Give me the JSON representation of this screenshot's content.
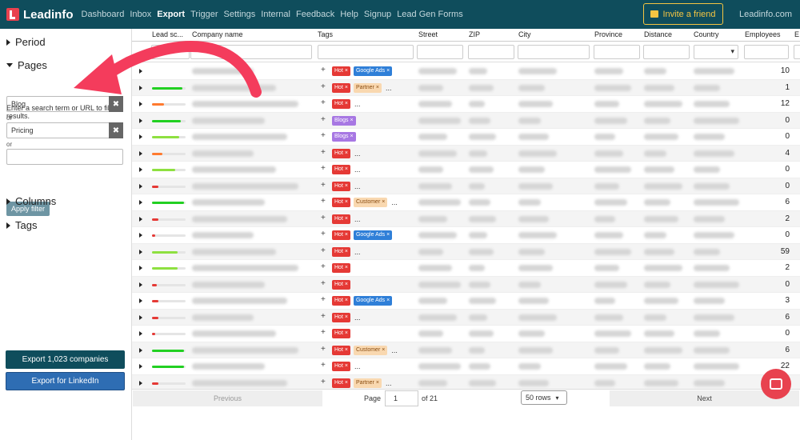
{
  "nav": {
    "brand": "Leadinfo",
    "links": [
      "Dashboard",
      "Inbox",
      "Export",
      "Trigger",
      "Settings",
      "Internal",
      "Feedback",
      "Help",
      "Signup",
      "Lead Gen Forms"
    ],
    "active": "Export",
    "invite_label": "Invite a friend",
    "domain": "Leadinfo.com"
  },
  "sidebar": {
    "period": "Period",
    "pages": "Pages",
    "hint": "Enter a search term or URL to filter results.",
    "filters": [
      {
        "value": "Blog"
      },
      {
        "value": "Pricing"
      },
      {
        "value": ""
      }
    ],
    "or_label": "or",
    "apply": "Apply filter",
    "columns": "Columns",
    "tags": "Tags",
    "export_companies": "Export 1,023 companies",
    "export_linkedin": "Export for LinkedIn"
  },
  "table": {
    "columns": [
      "Lead sc...",
      "Company name",
      "Tags",
      "Street",
      "ZIP",
      "City",
      "Province",
      "Distance",
      "Country",
      "Employees",
      "E"
    ],
    "rows": [
      {
        "score": 0.0,
        "tags": [],
        "employees": "10"
      },
      {
        "score": 0.9,
        "tags": [
          "hot",
          "partner"
        ],
        "more": true,
        "employees": "1"
      },
      {
        "score": 0.35,
        "tags": [
          "hot"
        ],
        "more": true,
        "employees": "12"
      },
      {
        "score": 0.85,
        "tags": [
          "blogs"
        ],
        "more": false,
        "employees": "0"
      },
      {
        "score": 0.8,
        "tags": [
          "blogs"
        ],
        "more": false,
        "employees": "0"
      },
      {
        "score": 0.3,
        "tags": [
          "hot"
        ],
        "more": true,
        "employees": "4"
      },
      {
        "score": 0.7,
        "tags": [
          "hot"
        ],
        "more": true,
        "employees": "0"
      },
      {
        "score": 0.2,
        "tags": [
          "hot"
        ],
        "more": true,
        "employees": "0"
      },
      {
        "score": 0.95,
        "tags": [
          "hot",
          "customer"
        ],
        "more": true,
        "employees": "6"
      },
      {
        "score": 0.2,
        "tags": [
          "hot"
        ],
        "more": true,
        "employees": "2"
      },
      {
        "score": 0.1,
        "tags": [
          "hot",
          "google"
        ],
        "more": false,
        "employees": "0"
      },
      {
        "score": 0.75,
        "tags": [
          "hot"
        ],
        "more": true,
        "employees": "59"
      },
      {
        "score": 0.75,
        "tags": [
          "hot"
        ],
        "more": false,
        "employees": "2"
      },
      {
        "score": 0.15,
        "tags": [
          "hot"
        ],
        "more": false,
        "employees": "0"
      },
      {
        "score": 0.2,
        "tags": [
          "hot",
          "google"
        ],
        "more": false,
        "employees": "3"
      },
      {
        "score": 0.2,
        "tags": [
          "hot"
        ],
        "more": true,
        "employees": "6"
      },
      {
        "score": 0.1,
        "tags": [
          "hot"
        ],
        "more": false,
        "employees": "0"
      },
      {
        "score": 0.95,
        "tags": [
          "hot",
          "customer"
        ],
        "more": true,
        "employees": "6"
      },
      {
        "score": 0.95,
        "tags": [
          "hot"
        ],
        "more": true,
        "employees": "22"
      },
      {
        "score": 0.2,
        "tags": [
          "hot",
          "partner"
        ],
        "more": true,
        "employees": "1"
      }
    ],
    "first_row_tags": [
      "hot",
      "google"
    ]
  },
  "tag_labels": {
    "hot": "Hot",
    "google": "Google Ads",
    "blogs": "Blogs",
    "partner": "Partner",
    "customer": "Customer"
  },
  "pager": {
    "prev": "Previous",
    "next": "Next",
    "page_label": "Page",
    "page": "1",
    "of": "of 21",
    "rows": "50 rows"
  },
  "colors": {
    "nav": "#0f4d5c",
    "accent": "#e8424f",
    "hot": "#e53935",
    "google": "#2f7fd8",
    "blogs": "#a777e3",
    "partner": "#f9d8b0",
    "score_high": "#22d022",
    "score_mid": "#8ee040",
    "score_low": "#e53935",
    "score_orange": "#ff7a2f"
  }
}
